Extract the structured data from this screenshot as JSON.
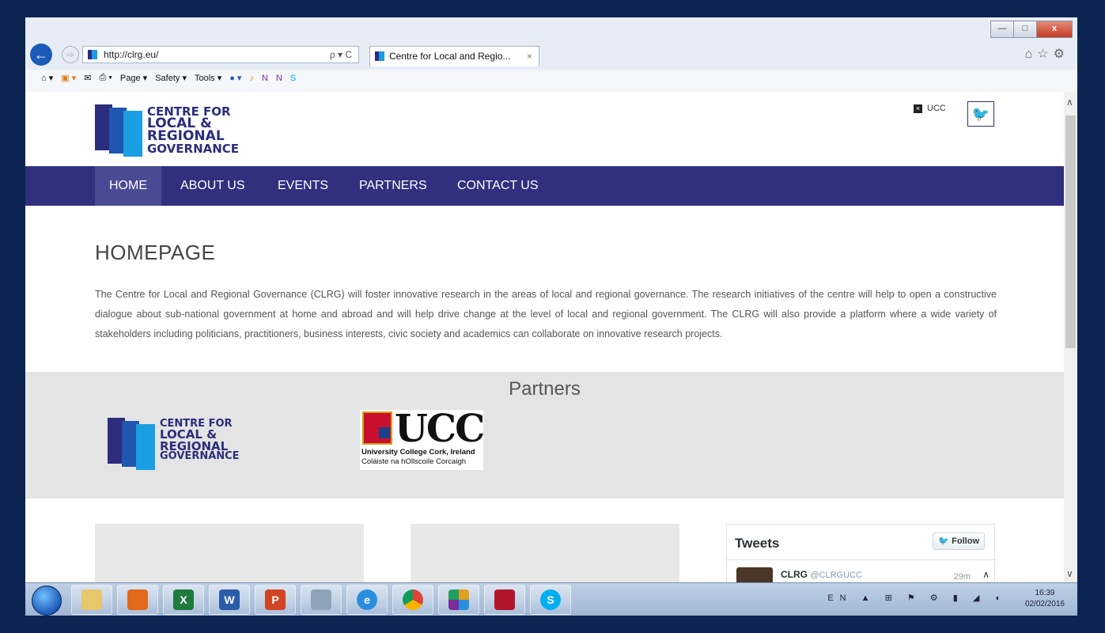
{
  "browser": {
    "url": "http://clrg.eu/",
    "tab_title": "Centre for Local and Regio...",
    "tab_close": "×",
    "search_symbol": "ρ ▾ C",
    "right_icons": "⌂☆⚙",
    "win_min": "—",
    "win_max": "□",
    "win_close": "x",
    "cmd": {
      "page": "Page ▾",
      "safety": "Safety ▾",
      "tools": "Tools ▾"
    }
  },
  "header": {
    "logo_lines": [
      "CENTRE FOR",
      "LOCAL &",
      "REGIONAL",
      "GOVERNANCE"
    ],
    "ucc_link": "UCC",
    "twitter_icon": "twitter-icon"
  },
  "nav": {
    "items": [
      {
        "label": "HOME"
      },
      {
        "label": "ABOUT US"
      },
      {
        "label": "EVENTS"
      },
      {
        "label": "PARTNERS"
      },
      {
        "label": "CONTACT US"
      }
    ]
  },
  "main": {
    "heading": "HOMEPAGE",
    "intro": "The Centre for Local and Regional Governance (CLRG) will foster innovative research in the areas of local and regional governance. The research initiatives of the centre will help to open a constructive dialogue about sub-national government at home and abroad and will help drive change at the level of local and regional government. The CLRG will also provide a platform where a wide variety of stakeholders including politicians, practitioners, business interests, civic society and academics can collaborate on innovative research projects."
  },
  "partners": {
    "title": "Partners",
    "ucc_word": "UCC",
    "ucc_line1": "University College Cork, Ireland",
    "ucc_line2": "Coláiste na hOllscoile Corcaigh"
  },
  "tweets": {
    "title": "Tweets",
    "follow": "Follow",
    "name": "CLRG",
    "handle": "@CLRGUCC",
    "time": "29m"
  },
  "taskbar": {
    "tray": "EN",
    "time": "16:39",
    "date": "02/02/2016"
  }
}
